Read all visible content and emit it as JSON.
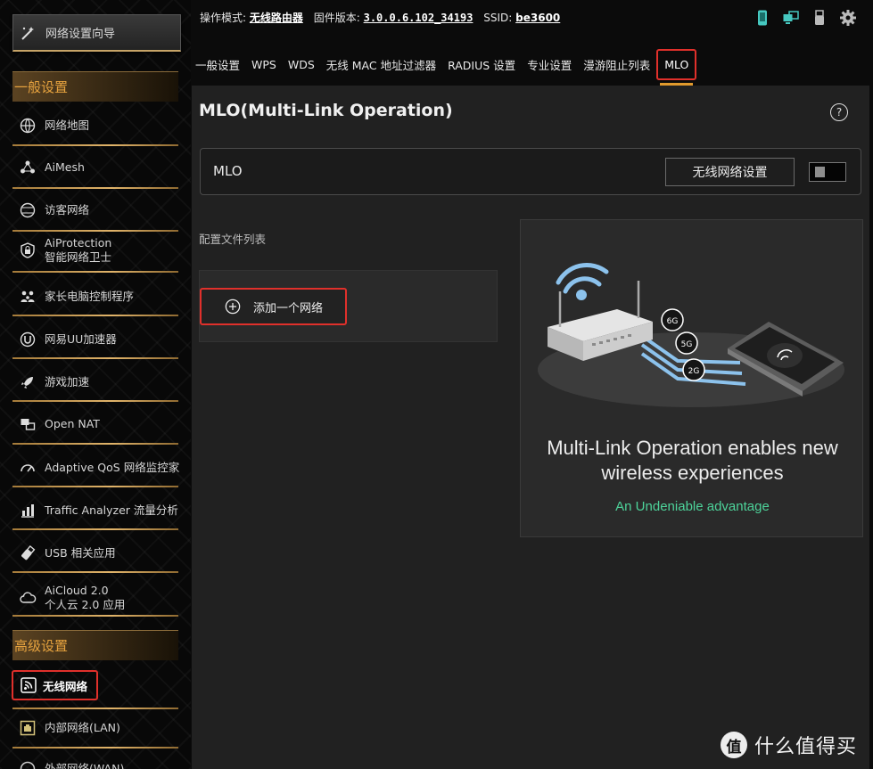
{
  "sidebar": {
    "wizard_label": "网络设置向导",
    "general_header": "一般设置",
    "items": [
      {
        "icon": "globe-map-icon",
        "label": "网络地图",
        "label2": ""
      },
      {
        "icon": "aimesh-icon",
        "label": "AiMesh",
        "label2": ""
      },
      {
        "icon": "globe-icon",
        "label": "访客网络",
        "label2": ""
      },
      {
        "icon": "shield-lock-icon",
        "label": "AiProtection",
        "label2": "智能网络卫士"
      },
      {
        "icon": "family-icon",
        "label": "家长电脑控制程序",
        "label2": ""
      },
      {
        "icon": "uu-accelerator-icon",
        "label": "网易UU加速器",
        "label2": ""
      },
      {
        "icon": "rocket-icon",
        "label": "游戏加速",
        "label2": ""
      },
      {
        "icon": "nat-icon",
        "label": "Open NAT",
        "label2": ""
      },
      {
        "icon": "gauge-icon",
        "label": "Adaptive QoS 网络监控家",
        "label2": ""
      },
      {
        "icon": "chart-icon",
        "label": "Traffic Analyzer 流量分析",
        "label2": ""
      },
      {
        "icon": "usb-icon",
        "label": "USB 相关应用",
        "label2": ""
      },
      {
        "icon": "cloud-icon",
        "label": "AiCloud 2.0",
        "label2": "个人云 2.0 应用"
      }
    ],
    "advanced_header": "高级设置",
    "adv_items": [
      {
        "icon": "wifi-icon",
        "label": "无线网络",
        "active": true
      },
      {
        "icon": "lan-icon",
        "label": "内部网络(LAN)",
        "active": false
      },
      {
        "icon": "wan-icon",
        "label": "外部网络(WAN)",
        "active": false
      }
    ]
  },
  "topbar": {
    "mode_label": "操作模式:",
    "mode_value": "无线路由器",
    "fw_label": "固件版本:",
    "fw_value": "3.0.0.6.102_34193",
    "ssid_label": "SSID:",
    "ssid_value": "be3600",
    "icons": [
      "phone-icon",
      "network-status-icon",
      "usb-status-icon",
      "gear-icon"
    ]
  },
  "tabs": [
    {
      "label": "一般设置",
      "active": false
    },
    {
      "label": "WPS",
      "active": false
    },
    {
      "label": "WDS",
      "active": false
    },
    {
      "label": "无线 MAC 地址过滤器",
      "active": false
    },
    {
      "label": "RADIUS 设置",
      "active": false
    },
    {
      "label": "专业设置",
      "active": false
    },
    {
      "label": "漫游阻止列表",
      "active": false
    },
    {
      "label": "MLO",
      "active": true
    }
  ],
  "main": {
    "title": "MLO(Multi-Link Operation)",
    "help": "?",
    "mlo_label": "MLO",
    "wireless_settings_button": "无线网络设置",
    "mlo_enabled": false,
    "profile_list_label": "配置文件列表",
    "add_network_button": "添加一个网络",
    "promo": {
      "headline": "Multi-Link Operation enables new wireless experiences",
      "tagline": "An Undeniable advantage",
      "bands": [
        "6G",
        "5G",
        "2G"
      ],
      "tagline_color": "#4dd39a"
    }
  },
  "watermark": {
    "badge": "值",
    "text": "什么值得买"
  },
  "colors": {
    "accent_gold": "#e7a33f",
    "highlight_red": "#e0302b",
    "tab_underline": "#e29a2d"
  }
}
